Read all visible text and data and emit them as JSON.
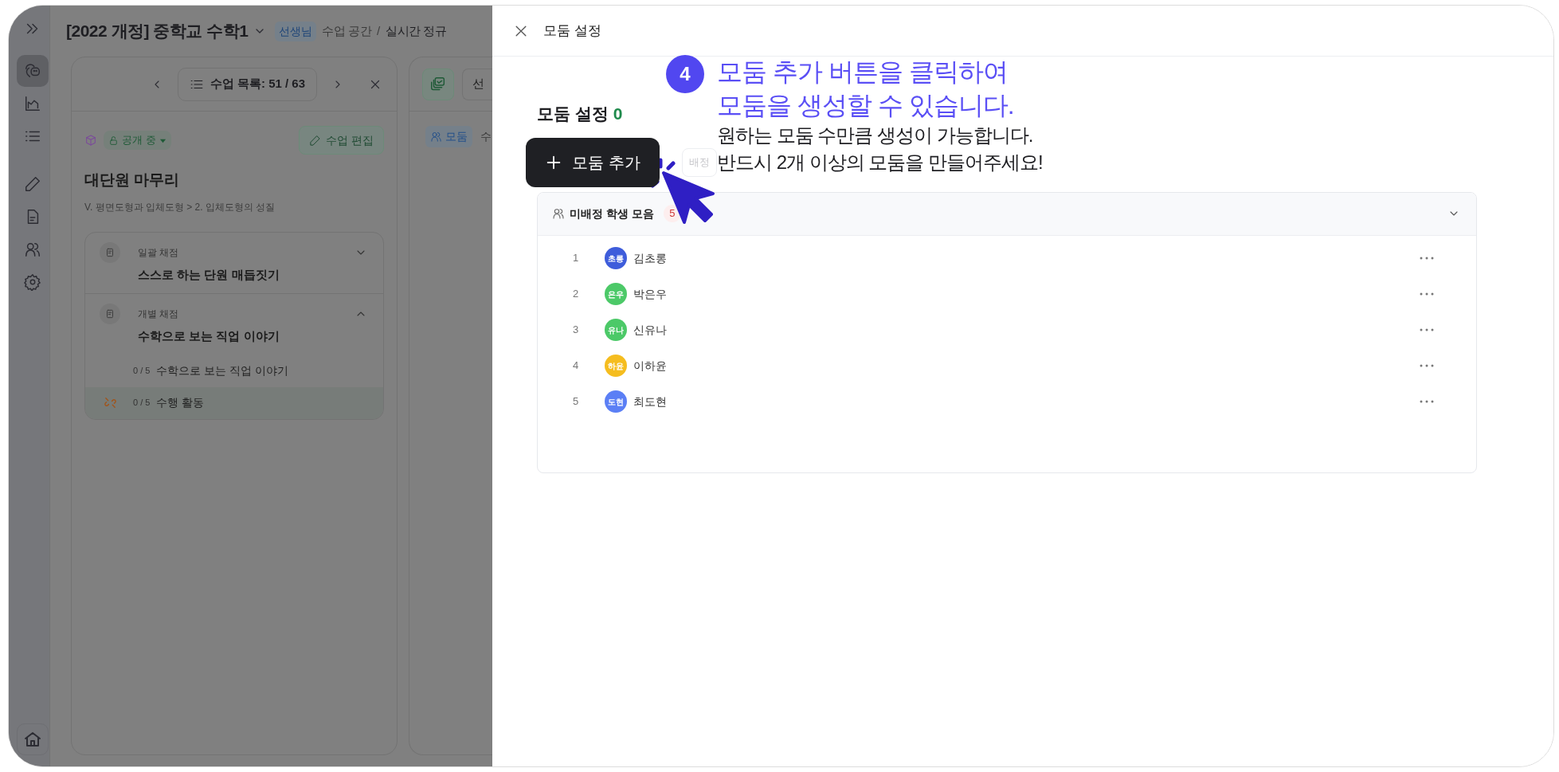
{
  "sidebar": {
    "items": [
      {
        "kind": "chat",
        "selected": true
      },
      {
        "kind": "chart",
        "selected": false
      },
      {
        "kind": "list",
        "selected": false
      },
      {
        "kind": "pencil",
        "selected": false
      },
      {
        "kind": "document",
        "selected": false
      },
      {
        "kind": "people",
        "selected": false
      },
      {
        "kind": "settings",
        "selected": false
      },
      {
        "kind": "home",
        "selected": false
      }
    ]
  },
  "header": {
    "title": "[2022 개정] 중학교 수학1",
    "role_badge": "선생님",
    "breadcrumb": [
      "수업 공간",
      "실시간 정규"
    ],
    "breadcrumb_separator": "/"
  },
  "lesson_panel": {
    "nav_label": "수업 목록: 51 / 63",
    "status": "공개 중",
    "edit_button": "수업 편집",
    "title": "대단원 마무리",
    "path": "V. 평면도형과 입체도형 > 2. 입체도형의 성질",
    "sections": [
      {
        "type": "일괄 채점",
        "title": "스스로 하는 단원 매듭짓기",
        "expanded": false
      },
      {
        "type": "개별 채점",
        "title": "수학으로 보는 직업 이야기",
        "expanded": true,
        "children": [
          {
            "count": "0 / 5",
            "title": "수학으로 보는 직업 이야기",
            "selected": false,
            "unlinked": false
          },
          {
            "count": "0 / 5",
            "title": "수행 활동",
            "selected": true,
            "unlinked": true
          }
        ]
      }
    ]
  },
  "second_panel": {
    "select_label": "선",
    "tab": "모둠",
    "text": "수"
  },
  "drawer": {
    "title": "모둠 설정",
    "heading": "모둠 설정",
    "count": "0",
    "add_button": "모둠 추가",
    "random_button": "배정",
    "group": {
      "title": "미배정 학생 모음",
      "count": "5",
      "expanded": true,
      "students": [
        {
          "number": "1",
          "initials": "초롱",
          "name": "김초롱",
          "color": "#3e5ddb"
        },
        {
          "number": "2",
          "initials": "은우",
          "name": "박은우",
          "color": "#4cc968"
        },
        {
          "number": "3",
          "initials": "유나",
          "name": "신유나",
          "color": "#4cc968"
        },
        {
          "number": "4",
          "initials": "하윤",
          "name": "이하윤",
          "color": "#f5bd1f"
        },
        {
          "number": "5",
          "initials": "도현",
          "name": "최도현",
          "color": "#5b7ff5"
        }
      ]
    }
  },
  "guide": {
    "step": "4",
    "headline": [
      "모둠 추가 버튼을 클릭하여",
      "모둠을 생성할 수 있습니다."
    ],
    "lines": [
      "원하는 모둠 수만큼 생성이 가능합니다.",
      "반드시 2개 이상의 모둠을 만들어주세요!"
    ]
  }
}
